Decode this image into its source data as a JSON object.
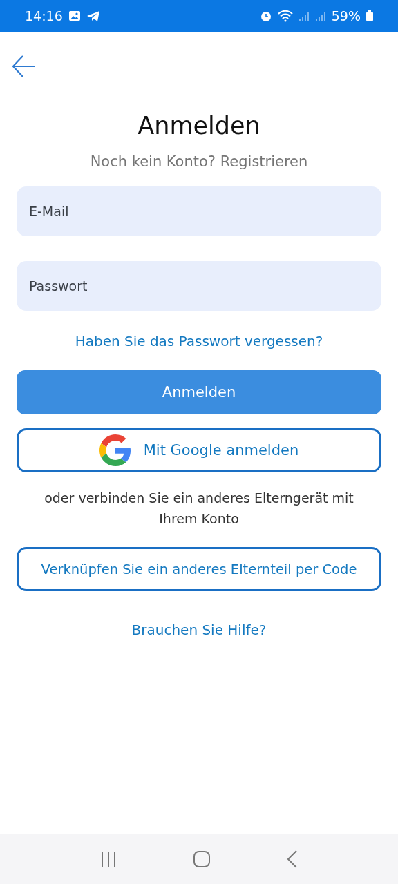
{
  "status_bar": {
    "time": "14:16",
    "battery": "59%"
  },
  "title": "Anmelden",
  "register_prompt": "Noch kein Konto? Registrieren",
  "fields": [
    {
      "placeholder": "E-Mail"
    },
    {
      "placeholder": "Passwort"
    }
  ],
  "forgot_password": "Haben Sie das Passwort vergessen?",
  "login_button": "Anmelden",
  "google_button": "Mit Google anmelden",
  "other_device_text": "oder verbinden Sie ein anderes Elterngerät mit Ihrem Konto",
  "code_button": "Verknüpfen Sie ein anderes Elternteil per Code",
  "help_link": "Brauchen Sie Hilfe?"
}
